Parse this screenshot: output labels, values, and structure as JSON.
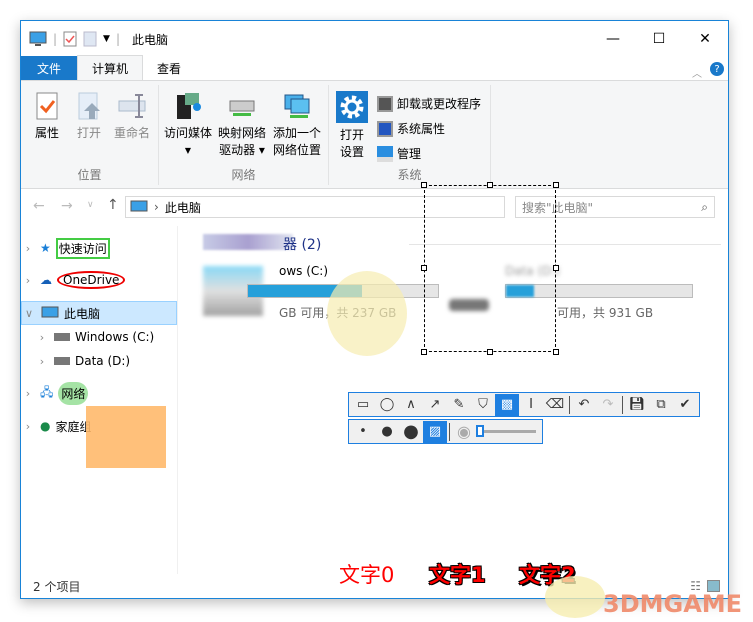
{
  "window": {
    "title": "此电脑",
    "minimize": "—",
    "maximize": "☐",
    "close": "✕"
  },
  "tabs": [
    {
      "label": "文件"
    },
    {
      "label": "计算机"
    },
    {
      "label": "查看"
    }
  ],
  "ribbon": {
    "location": {
      "label": "位置",
      "items": [
        "属性",
        "打开",
        "重命名"
      ]
    },
    "network": {
      "label": "网络",
      "access_media": "访问媒体",
      "map_drive_1": "映射网络",
      "map_drive_2": "驱动器",
      "add_loc_1": "添加一个",
      "add_loc_2": "网络位置"
    },
    "system": {
      "label": "系统",
      "open_1": "打开",
      "open_2": "设置",
      "uninstall": "卸载或更改程序",
      "props": "系统属性",
      "manage": "管理"
    }
  },
  "address": {
    "path": "此电脑",
    "search_placeholder": "搜索\"此电脑\""
  },
  "nav": [
    {
      "label": "快速访问"
    },
    {
      "label": "OneDrive"
    },
    {
      "label": "此电脑"
    },
    {
      "label": "Windows (C:)"
    },
    {
      "label": "Data (D:)"
    },
    {
      "label": "网络"
    },
    {
      "label": "家庭组"
    }
  ],
  "main": {
    "group_header": "器 (2)",
    "drive_c_name": "ows (C:)",
    "drive_c_space": "GB 可用，共 237 GB",
    "drive_d_name": "Data (D:)",
    "drive_d_space": "可用，共 931 GB",
    "drive_c_usage": 0.6,
    "drive_d_usage": 0.15
  },
  "annot_text": [
    "文字0",
    "文字1",
    "文字2"
  ],
  "status": {
    "count": "2 个项目"
  },
  "watermark": "3DMGAME"
}
